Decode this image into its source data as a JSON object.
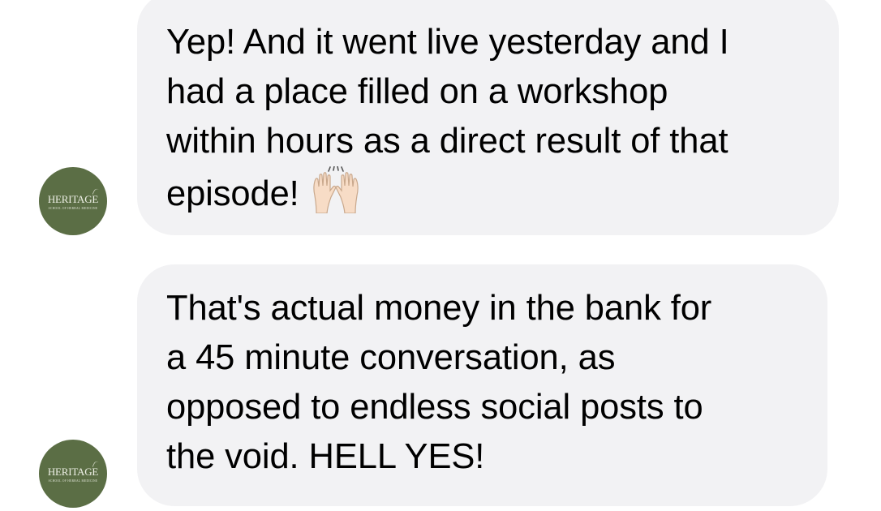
{
  "thread": {
    "messages": [
      {
        "sender_avatar": {
          "logo_text": "HERITAGE",
          "subtitle": "SCHOOL OF HERBAL MEDICINE",
          "color": "#5b6e45"
        },
        "text": "Yep! And it went live yesterday and I\nhad a place filled on a workshop\nwithin hours as a direct result of that\nepisode!",
        "emoji": "raising-hands-emoji"
      },
      {
        "sender_avatar": {
          "logo_text": "HERITAGE",
          "subtitle": "SCHOOL OF HERBAL MEDICINE",
          "color": "#5b6e45"
        },
        "text": "That's actual money in the bank for\na 45 minute conversation, as\nopposed to endless social posts to\nthe void. HELL YES!"
      }
    ]
  },
  "colors": {
    "bubble_background": "#f2f2f4",
    "text": "#000000",
    "avatar_background": "#5b6e45",
    "page_background": "#ffffff"
  }
}
